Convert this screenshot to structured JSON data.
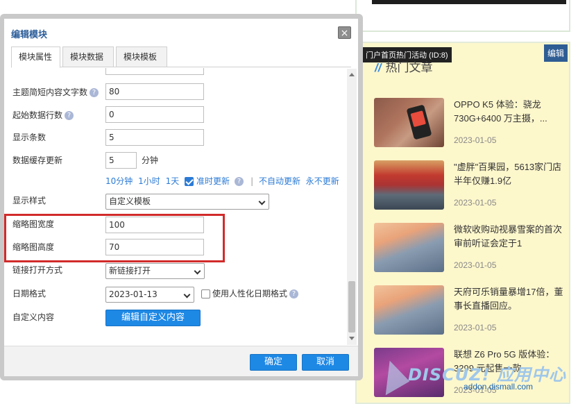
{
  "dialog": {
    "title": "编辑模块",
    "close_label": "×",
    "tabs": [
      {
        "label": "模块属性"
      },
      {
        "label": "模块数据"
      },
      {
        "label": "模块模板"
      }
    ]
  },
  "form": {
    "fields": [
      {
        "label": "主题简短内容文字数",
        "value": "80"
      },
      {
        "label": "起始数据行数",
        "value": "0"
      },
      {
        "label": "显示条数",
        "value": "5"
      },
      {
        "label": "数据缓存更新",
        "value": "5",
        "unit": "分钟"
      },
      {
        "label": "显示样式",
        "value": "自定义模板"
      },
      {
        "label": "缩略图宽度",
        "value": "100"
      },
      {
        "label": "缩略图高度",
        "value": "70"
      },
      {
        "label": "链接打开方式",
        "value": "新链接打开"
      },
      {
        "label": "日期格式",
        "value": "2023-01-13",
        "checkbox_label": "使用人性化日期格式"
      },
      {
        "label": "自定义内容",
        "button": "编辑自定义内容"
      }
    ],
    "cache_links": [
      "10分钟",
      "1小时",
      "1天"
    ],
    "cache_check_label": "准时更新",
    "cache_link_no_auto": "不自动更新",
    "cache_link_never": "永不更新",
    "help_glyph": "?"
  },
  "footer": {
    "ok": "确定",
    "cancel": "取消"
  },
  "hot_panel": {
    "tooltip": "门户首页热门活动 (ID:8)",
    "edit": "编辑",
    "title": "热门文章",
    "articles": [
      {
        "title": "OPPO K5 体验：骁龙730G+6400 万主摄，...",
        "date": "2023-01-05"
      },
      {
        "title": "\"虚胖\"百果园，5613家门店半年仅赚1.9亿",
        "date": "2023-01-05"
      },
      {
        "title": "微软收购动视暴雪案的首次审前听证会定于1",
        "date": "2023-01-05"
      },
      {
        "title": "天府可乐销量暴增17倍，董事长直播回应。",
        "date": "2023-01-05"
      },
      {
        "title": "联想 Z6 Pro 5G 版体验：3299 元起售一款",
        "date": "2023-01-05"
      }
    ]
  },
  "watermark": {
    "brand": "DISCUZ! 应用中心",
    "url": "addon.dismall.com"
  },
  "colors": {
    "accent": "#1e88e5",
    "title_blue": "#2b5d99",
    "highlight": "#d22a2a",
    "panel_bg": "#fdf7cc"
  }
}
